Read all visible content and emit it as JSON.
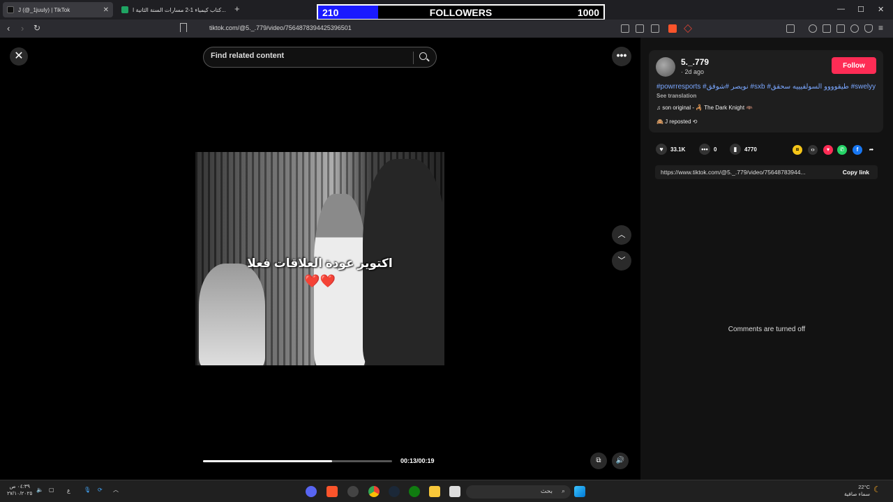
{
  "browser": {
    "tabs": [
      {
        "title": "J (@_1juuly) | TikTok",
        "icon": "tiktok-icon"
      },
      {
        "title": "كتاب كيمياء 1-2 مسارات السنة الثانية ا...",
        "icon": "sheets-icon"
      }
    ],
    "new_tab": "+",
    "url": "tiktok.com/@5._.779/video/7564878394425396501",
    "window_controls": {
      "minimize": "—",
      "maximize": "☐",
      "close": "✕"
    }
  },
  "followers_overlay": {
    "current": "210",
    "label": "FOLLOWERS",
    "goal": "1000",
    "progress_fraction": 0.21,
    "fill_color": "#1a1aff"
  },
  "player": {
    "search_placeholder": "Find related content",
    "caption": "اكتوير عودة العلاقات فعلا",
    "hearts": "❤️❤️",
    "time": "00:13/00:19",
    "progress_fraction": 0.684
  },
  "post": {
    "username": "5._.779",
    "meta": "· 2d ago",
    "follow_label": "Follow",
    "hashtags": "#powrresports #نويصر #شوقق #sxb #طيقوووو السولفيييه سحقق #swelyy",
    "see_translation": "See translation",
    "music": "♫  son original - 🦂 The Dark Knight 🦇",
    "repost": "🙈 J reposted  ⟲",
    "likes": "33.1K",
    "comments": "0",
    "saves": "4770",
    "link": "https://www.tiktok.com/@5._.779/video/75648783944...",
    "copy_link": "Copy link",
    "comments_off": "Comments are turned off"
  },
  "taskbar": {
    "search_text": "بحث",
    "clock_time": "٠٤:٣٩ ص",
    "clock_date": "٢٧/١٠/٢٠٢٥",
    "weather_temp": "22°C",
    "weather_desc": "سماء صافية",
    "lang": "ع"
  },
  "colors": {
    "follow": "#fe2c55",
    "hashtag": "#7aa7ff"
  }
}
